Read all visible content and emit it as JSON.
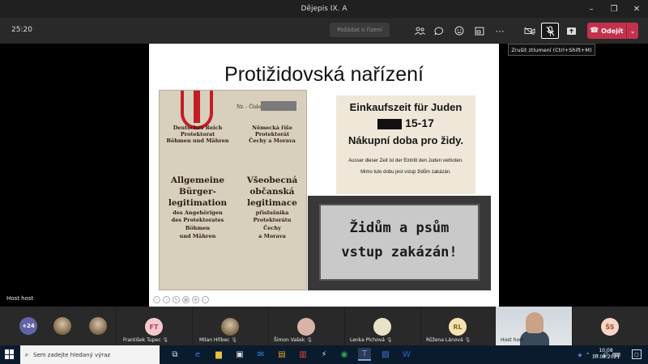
{
  "window": {
    "title": "Dějepis IX. A",
    "controls": [
      "–",
      "❐",
      "✕"
    ]
  },
  "meeting": {
    "timer": "25:20",
    "raise_hand_label": "Požádat o řízení",
    "leave_label": "Odejít",
    "tooltip": "Zrušit ztlumení (Ctrl+Shift+M)",
    "host_label": "Host host"
  },
  "slide": {
    "title": "Protižidovská nařízení",
    "id_card": {
      "number_label": "Nr. - Číslo",
      "col1_header": [
        "Deutsches Reich",
        "Protektorat",
        "Böhmen und Mähren"
      ],
      "col2_header": [
        "Německá říše",
        "Protektorát",
        "Čechy a Morava"
      ],
      "col1_body": [
        "Allgemeine",
        "Bürger-",
        "legitimation"
      ],
      "col1_small": [
        "des Angehörigen",
        "des Protektorates",
        "Böhmen",
        "und Mähren"
      ],
      "col2_body": [
        "Všeobecná",
        "občanská",
        "legitimace"
      ],
      "col2_small": [
        "příslušníka",
        "Protektorátu",
        "Čechy",
        "a Morava"
      ]
    },
    "shop_notice": {
      "headline_de": "Einkaufszeit für Juden",
      "hours": "15-17",
      "headline_cz": "Nákupní doba pro židy.",
      "small_de": "Ausser dieser Zeit ist der Eintritt den Juden verboten.",
      "small_cz": "Mimo tuto dobu jest vstup židům zakázán."
    },
    "sign": {
      "line1": "Židům a psům",
      "line2": "vstup zakázán!"
    }
  },
  "participants": {
    "overflow": "+24",
    "people": [
      {
        "name": "František Tupec",
        "initials": "FT"
      },
      {
        "name": "Milan Hříbec",
        "initials": ""
      },
      {
        "name": "Šimon Vašek",
        "initials": ""
      },
      {
        "name": "Lenka Plchová",
        "initials": ""
      },
      {
        "name": "Růžena Lánová",
        "initials": "RL"
      },
      {
        "name": "Host host",
        "initials": ""
      },
      {
        "name": "",
        "initials": "ŠS"
      }
    ]
  },
  "taskbar": {
    "search_placeholder": "Sem zadejte hledaný výraz",
    "time": "10:08",
    "date": "10.03.2021"
  }
}
